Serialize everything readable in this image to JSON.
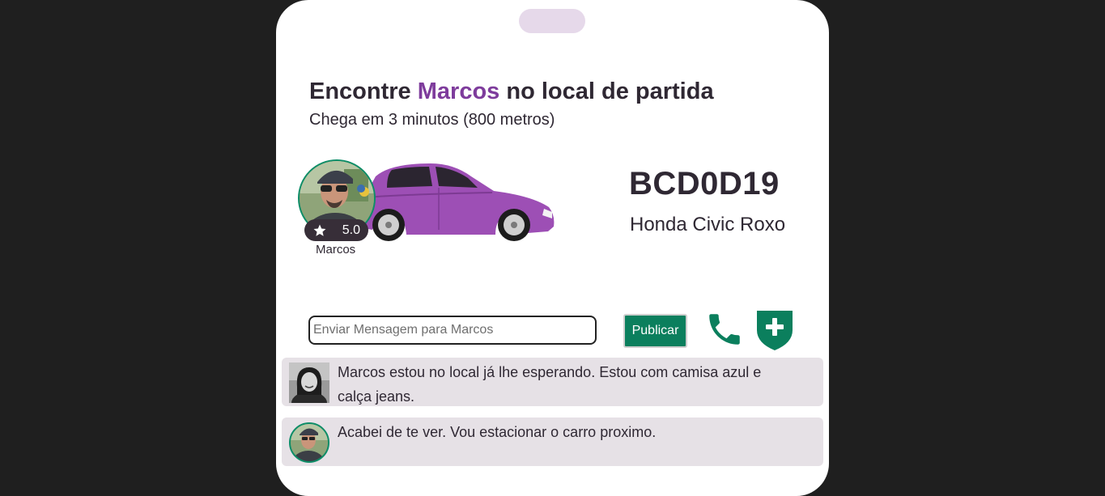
{
  "header": {
    "title_before": "Encontre ",
    "title_name": "Marcos",
    "title_after": " no local de partida",
    "subtitle": "Chega em 3 minutos (800 metros)"
  },
  "driver": {
    "name": "Marcos",
    "rating": "5.0"
  },
  "vehicle": {
    "plate": "BCD0D19",
    "model": "Honda Civic Roxo",
    "color": "#9d4fb5"
  },
  "message_bar": {
    "placeholder": "Enviar Mensagem para Marcos",
    "value": "",
    "publish_label": "Publicar",
    "call_icon": "phone-icon",
    "safety_icon": "shield-plus-icon"
  },
  "messages": [
    {
      "text": "Marcos estou no local já lhe esperando. Estou com camisa azul e calça jeans."
    },
    {
      "text": "Acabei de te ver. Vou estacionar o carro proximo."
    }
  ],
  "colors": {
    "accent": "#7e3c9c",
    "primary": "#0b7f5d",
    "background": "#1f1f1f",
    "chat_bubble": "#e6e1e6"
  }
}
